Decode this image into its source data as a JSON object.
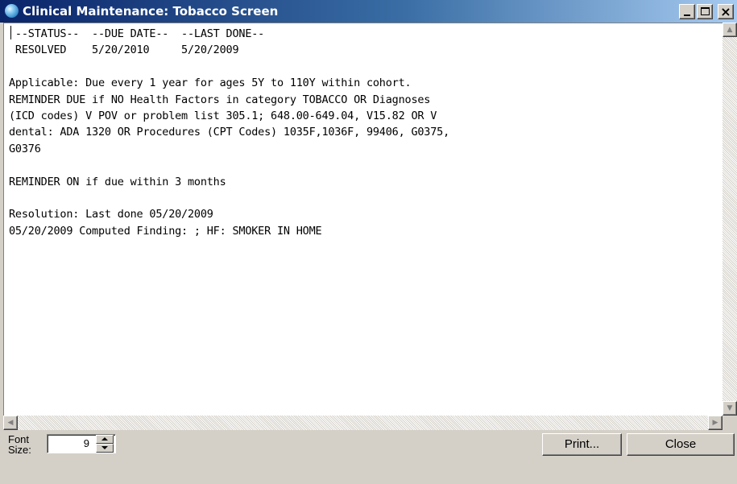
{
  "window": {
    "title": "Clinical Maintenance: Tobacco Screen",
    "controls": {
      "minimize": "_",
      "maximize": "□",
      "close": "×"
    }
  },
  "report": {
    "lines": [
      " --STATUS--  --DUE DATE--  --LAST DONE--",
      " RESOLVED    5/20/2010     5/20/2009",
      "",
      "Applicable: Due every 1 year for ages 5Y to 110Y within cohort.",
      "REMINDER DUE if NO Health Factors in category TOBACCO OR Diagnoses",
      "(ICD codes) V POV or problem list 305.1; 648.00-649.04, V15.82 OR V",
      "dental: ADA 1320 OR Procedures (CPT Codes) 1035F,1036F, 99406, G0375,",
      "G0376",
      "",
      "REMINDER ON if due within 3 months",
      "",
      "Resolution: Last done 05/20/2009",
      "05/20/2009 Computed Finding: ; HF: SMOKER IN HOME"
    ]
  },
  "scrollbars": {
    "up_arrow": "▲",
    "down_arrow": "▼",
    "left_arrow": "◀",
    "right_arrow": "▶"
  },
  "footer": {
    "font_size_label": "Font Size:",
    "font_size_value": "9",
    "print_label": "Print...",
    "close_label": "Close"
  },
  "colors": {
    "title_bar_start": "#0a246a",
    "title_bar_end": "#a6caf0",
    "window_face": "#d4d0c8",
    "text_area": "#ffffff"
  }
}
